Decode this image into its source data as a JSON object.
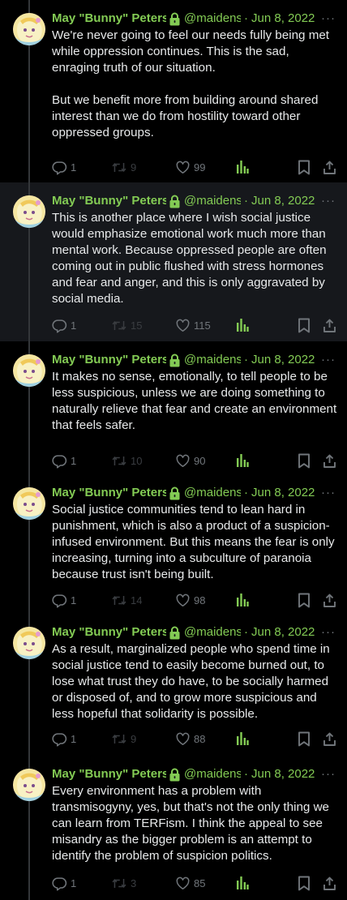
{
  "author": {
    "display_name": "May \"Bunny\" Peters",
    "handle": "@maidens",
    "lock_icon": "lock-icon",
    "accent": "#83cb54"
  },
  "tweets": [
    {
      "date": "Jun 8, 2022",
      "text": "We're never going to feel our needs fully being met while oppression continues. This is the sad, enraging truth of our situation.\n\nBut we benefit more from building around shared interest than we do from hostility toward other oppressed groups.",
      "replies": "1",
      "retweets": "9",
      "likes": "99"
    },
    {
      "date": "Jun 8, 2022",
      "text": "This is another place where I wish social justice would emphasize emotional work much more than mental work. Because oppressed people are often coming out in public flushed with stress hormones and fear and anger, and this is only aggravated by social media.",
      "replies": "1",
      "retweets": "15",
      "likes": "115"
    },
    {
      "date": "Jun 8, 2022",
      "text": "It makes no sense, emotionally, to tell people to be less suspicious, unless we are doing something to naturally relieve that fear and create an environment that feels safer.",
      "replies": "1",
      "retweets": "10",
      "likes": "90"
    },
    {
      "date": "Jun 8, 2022",
      "text": "Social justice communities tend to lean hard in punishment, which is also a product of a suspicion-infused environment. But this means the fear is only increasing, turning into a subculture of paranoia because trust isn't being built.",
      "replies": "1",
      "retweets": "14",
      "likes": "98"
    },
    {
      "date": "Jun 8, 2022",
      "text": "As a result, marginalized people who spend time in social justice tend to easily become burned out, to lose what trust they do have, to be socially harmed or disposed of, and to grow more suspicious and less hopeful that solidarity is possible.",
      "replies": "1",
      "retweets": "9",
      "likes": "88"
    },
    {
      "date": "Jun 8, 2022",
      "text": "Every environment has a problem with transmisogyny, yes, but that's not the only thing we can learn from TERFism. I think the appeal to see misandry as the bigger problem is an attempt to identify the problem of suspicion politics.",
      "replies": "1",
      "retweets": "3",
      "likes": "85"
    }
  ]
}
